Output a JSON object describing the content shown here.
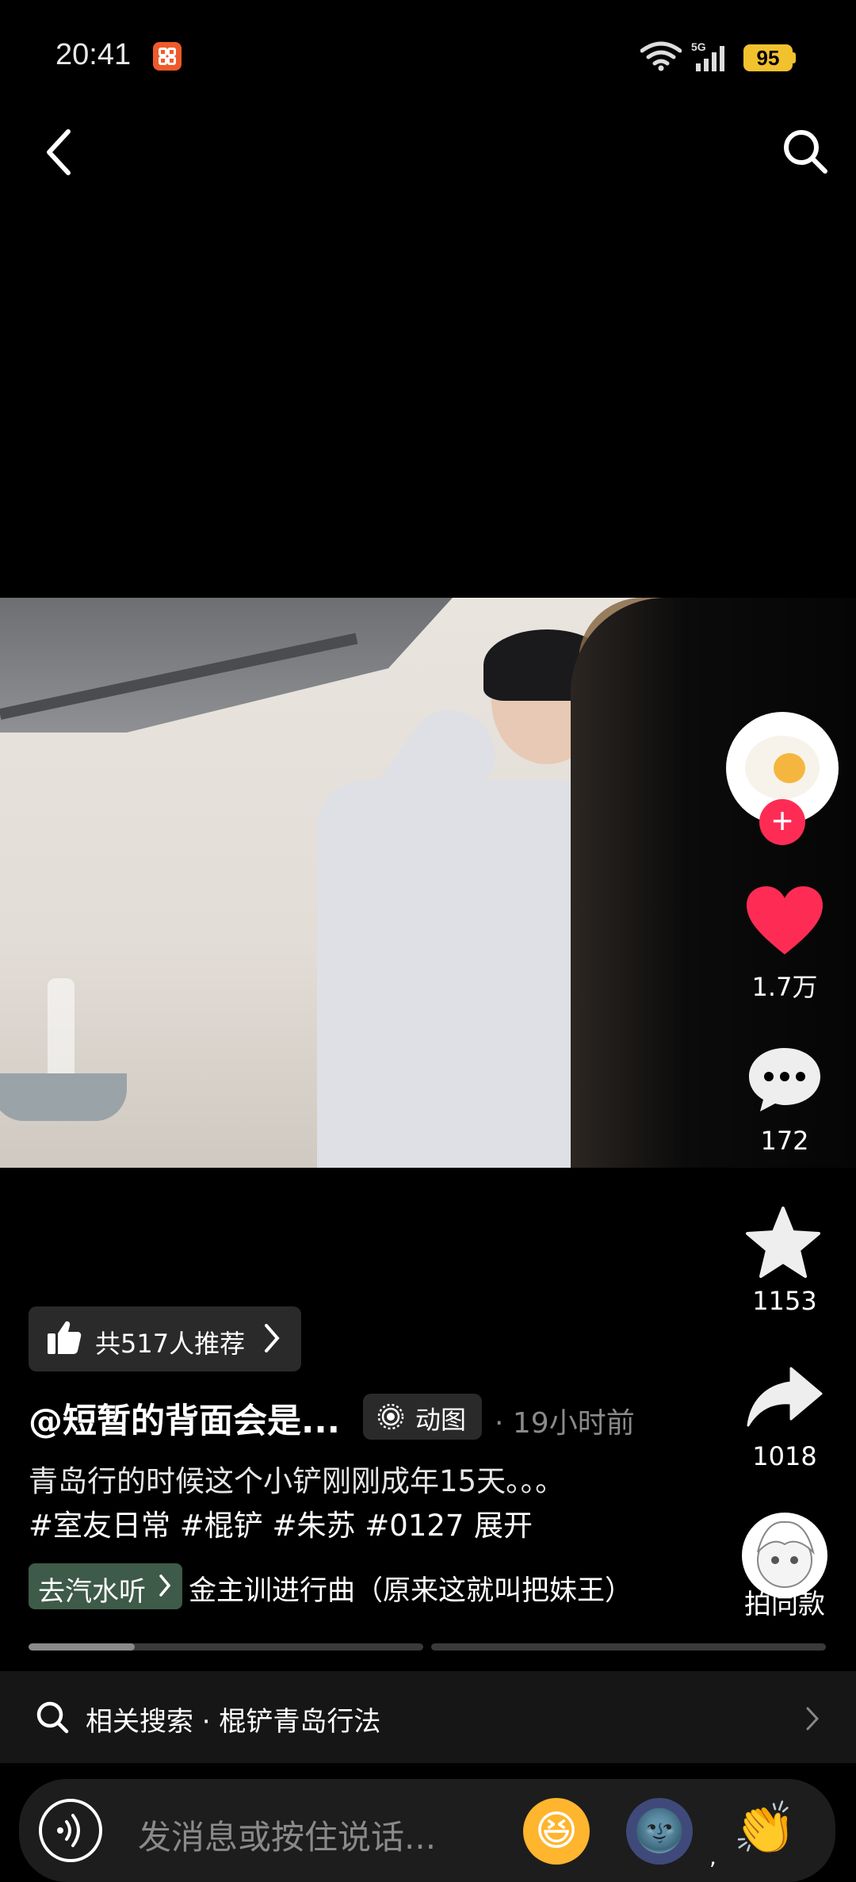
{
  "status_bar": {
    "time": "20:41",
    "network": "5G",
    "battery": "95"
  },
  "video": {
    "alt": ""
  },
  "rail": {
    "likes": "1.7万",
    "comments": "172",
    "favorites": "1153",
    "shares": "1018",
    "same_style_label": "拍同款"
  },
  "recommend": {
    "label": "共517人推荐"
  },
  "post": {
    "author": "@短暂的背面会是...",
    "badge": "动图",
    "time_ago": "· 19小时前",
    "description": "青岛行的时候这个小铲刚刚成年15天。。。",
    "hashtags": "#室友日常 #棍铲 #朱苏 #0127",
    "expand": "展开"
  },
  "music": {
    "button_label": "去汽水听",
    "title": "金主训进行曲（原来这就叫把妹王）"
  },
  "progress": {
    "current_fraction": 0.27
  },
  "related": {
    "text": "相关搜索 · 棍铲青岛行法"
  },
  "input": {
    "placeholder": "发消息或按住说话..."
  },
  "emojis": [
    "😆",
    "🌚",
    "👏"
  ],
  "colors": {
    "accent": "#fe2c55",
    "badge_bg": "#2a2a2a",
    "music_bg": "#3e5a48"
  }
}
